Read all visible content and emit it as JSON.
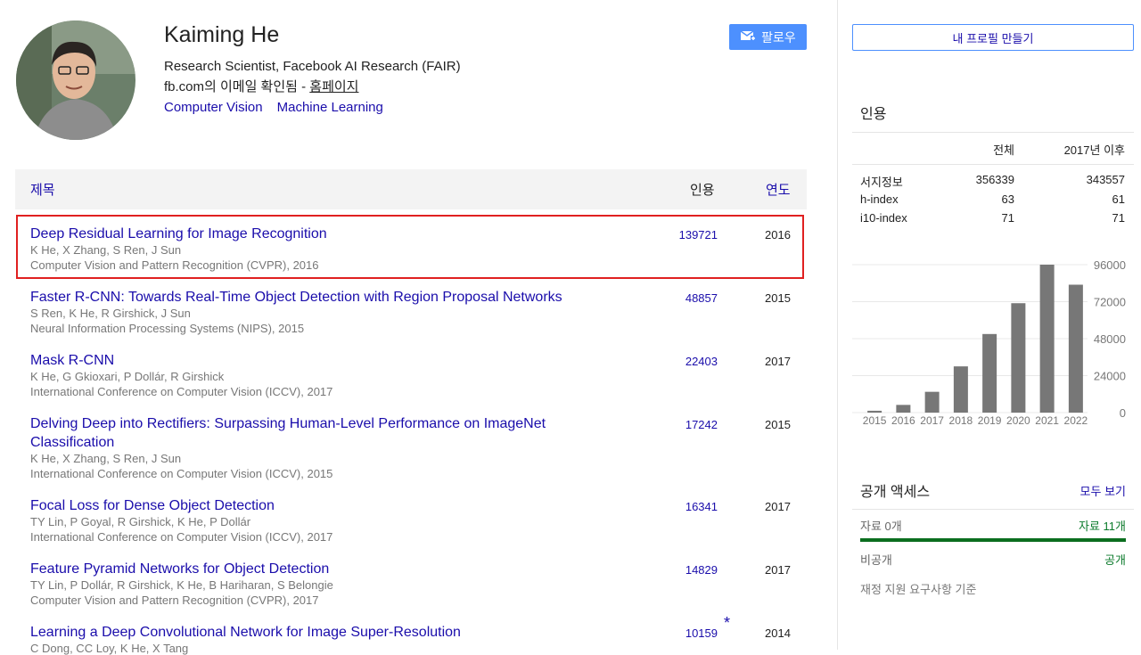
{
  "profile": {
    "name": "Kaiming He",
    "affiliation": "Research Scientist, Facebook AI Research (FAIR)",
    "email_text": "fb.com의 이메일 확인됨 - ",
    "homepage_label": "홈페이지",
    "interests": [
      "Computer Vision",
      "Machine Learning"
    ],
    "follow_label": "팔로우"
  },
  "table": {
    "header_title": "제목",
    "header_cited": "인용",
    "header_year": "연도",
    "rows": [
      {
        "title": "Deep Residual Learning for Image Recognition",
        "authors": "K He, X Zhang, S Ren, J Sun",
        "venue": "Computer Vision and Pattern Recognition (CVPR), 2016",
        "cited": "139721",
        "year": "2016"
      },
      {
        "title": "Faster R-CNN: Towards Real-Time Object Detection with Region Proposal Networks",
        "authors": "S Ren, K He, R Girshick, J Sun",
        "venue": "Neural Information Processing Systems (NIPS), 2015",
        "cited": "48857",
        "year": "2015"
      },
      {
        "title": "Mask R-CNN",
        "authors": "K He, G Gkioxari, P Dollár, R Girshick",
        "venue": "International Conference on Computer Vision (ICCV), 2017",
        "cited": "22403",
        "year": "2017"
      },
      {
        "title": "Delving Deep into Rectifiers: Surpassing Human-Level Performance on ImageNet Classification",
        "authors": "K He, X Zhang, S Ren, J Sun",
        "venue": "International Conference on Computer Vision (ICCV), 2015",
        "cited": "17242",
        "year": "2015"
      },
      {
        "title": "Focal Loss for Dense Object Detection",
        "authors": "TY Lin, P Goyal, R Girshick, K He, P Dollár",
        "venue": "International Conference on Computer Vision (ICCV), 2017",
        "cited": "16341",
        "year": "2017"
      },
      {
        "title": "Feature Pyramid Networks for Object Detection",
        "authors": "TY Lin, P Dollár, R Girshick, K He, B Hariharan, S Belongie",
        "venue": "Computer Vision and Pattern Recognition (CVPR), 2017",
        "cited": "14829",
        "year": "2017"
      },
      {
        "title": "Learning a Deep Convolutional Network for Image Super-Resolution",
        "authors": "C Dong, CC Loy, K He, X Tang",
        "venue": "",
        "cited": "10159",
        "year": "2014",
        "star": "*"
      }
    ]
  },
  "sidebar": {
    "make_profile": "내 프로필 만들기",
    "cited_title": "인용",
    "col_all": "전체",
    "col_since": "2017년 이후",
    "stats": [
      {
        "label": "서지정보",
        "all": "356339",
        "since": "343557"
      },
      {
        "label": "h-index",
        "all": "63",
        "since": "61"
      },
      {
        "label": "i10-index",
        "all": "71",
        "since": "71"
      }
    ],
    "open_access_title": "공개 액세스",
    "open_access_all": "모두 보기",
    "oa_unavailable": "자료 0개",
    "oa_available": "자료 11개",
    "oa_private": "비공개",
    "oa_public": "공개",
    "oa_note": "재정 지원 요구사항 기준"
  },
  "chart_data": {
    "type": "bar",
    "categories": [
      "2015",
      "2016",
      "2017",
      "2018",
      "2019",
      "2020",
      "2021",
      "2022"
    ],
    "values": [
      1200,
      5000,
      13500,
      30000,
      51000,
      71000,
      96000,
      83000
    ],
    "ylim": [
      0,
      96000
    ],
    "yticks": [
      "96000",
      "72000",
      "48000",
      "24000",
      "0"
    ],
    "bar_color": "#777777"
  }
}
